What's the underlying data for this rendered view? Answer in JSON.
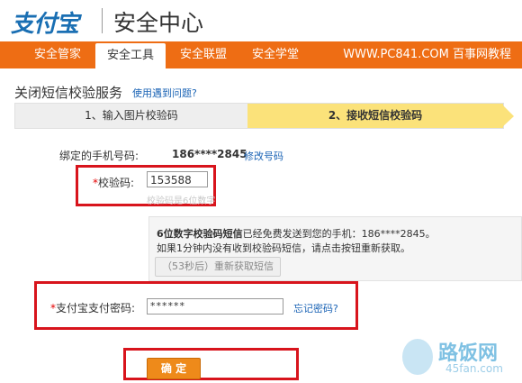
{
  "header": {
    "logo": "支付宝",
    "title": "安全中心"
  },
  "nav": {
    "tabs": [
      {
        "label": "安全管家"
      },
      {
        "label": "安全工具"
      },
      {
        "label": "安全联盟"
      },
      {
        "label": "安全学堂"
      }
    ],
    "active_index": 1,
    "right_text": "WWW.PC841.COM 百事网教程"
  },
  "page": {
    "title": "关闭短信校验服务",
    "help_link": "使用遇到问题?"
  },
  "steps": {
    "step1": "1、输入图片校验码",
    "step2": "2、接收短信校验码"
  },
  "form": {
    "phone_label": "绑定的手机号码:",
    "phone_value": "186****2845",
    "modify_link": "修改号码",
    "required_mark": "*",
    "code_label": "校验码:",
    "code_value": "153588",
    "code_hint": "校验码是6位数字",
    "info_bold": "6位数字校验码短信",
    "info_rest": "已经免费发送到您的手机：186****2845。",
    "info_line2": "如果1分钟内没有收到校验码短信，请点击按钮重新获取。",
    "resend_label": "（53秒后）重新获取短信",
    "pwd_label": "支付宝支付密码:",
    "pwd_value": "******",
    "forgot_link": "忘记密码?",
    "confirm_label": "确 定"
  },
  "watermark": {
    "text": "路饭网",
    "sub": "45fan.com"
  },
  "colors": {
    "brand_orange": "#ee6d14",
    "highlight_box": "#d8141c",
    "step_active": "#fbe27a",
    "link": "#1a63b5"
  }
}
